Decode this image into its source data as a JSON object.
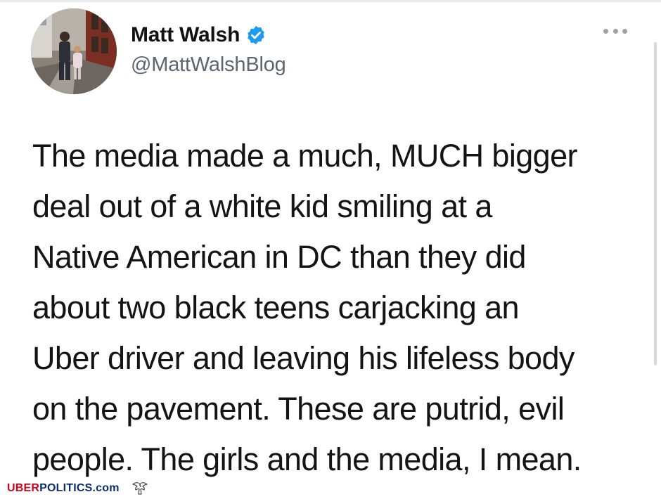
{
  "author": {
    "display_name": "Matt Walsh",
    "handle": "@MattWalshBlog",
    "verified": true,
    "avatar": "avatar-photo"
  },
  "menu": {
    "icon": "more-options-icon"
  },
  "tweet": {
    "lines": [
      "The media made a much, MUCH bigger",
      "deal out of a white kid smiling at a",
      "Native American in DC than they did",
      "about two black teens carjacking an",
      "Uber driver and leaving his lifeless body",
      "on the pavement. These are putrid, evil",
      "people. The girls and the media, I mean."
    ]
  },
  "watermark": {
    "part1": "UBER",
    "part2": "POLITICS",
    "part3": ".com",
    "icon": "eagle-icon"
  },
  "colors": {
    "verified": "#1d9bf0",
    "handle": "#5b6670",
    "watermark_red": "#d0021b",
    "watermark_blue": "#0b2e6b"
  }
}
